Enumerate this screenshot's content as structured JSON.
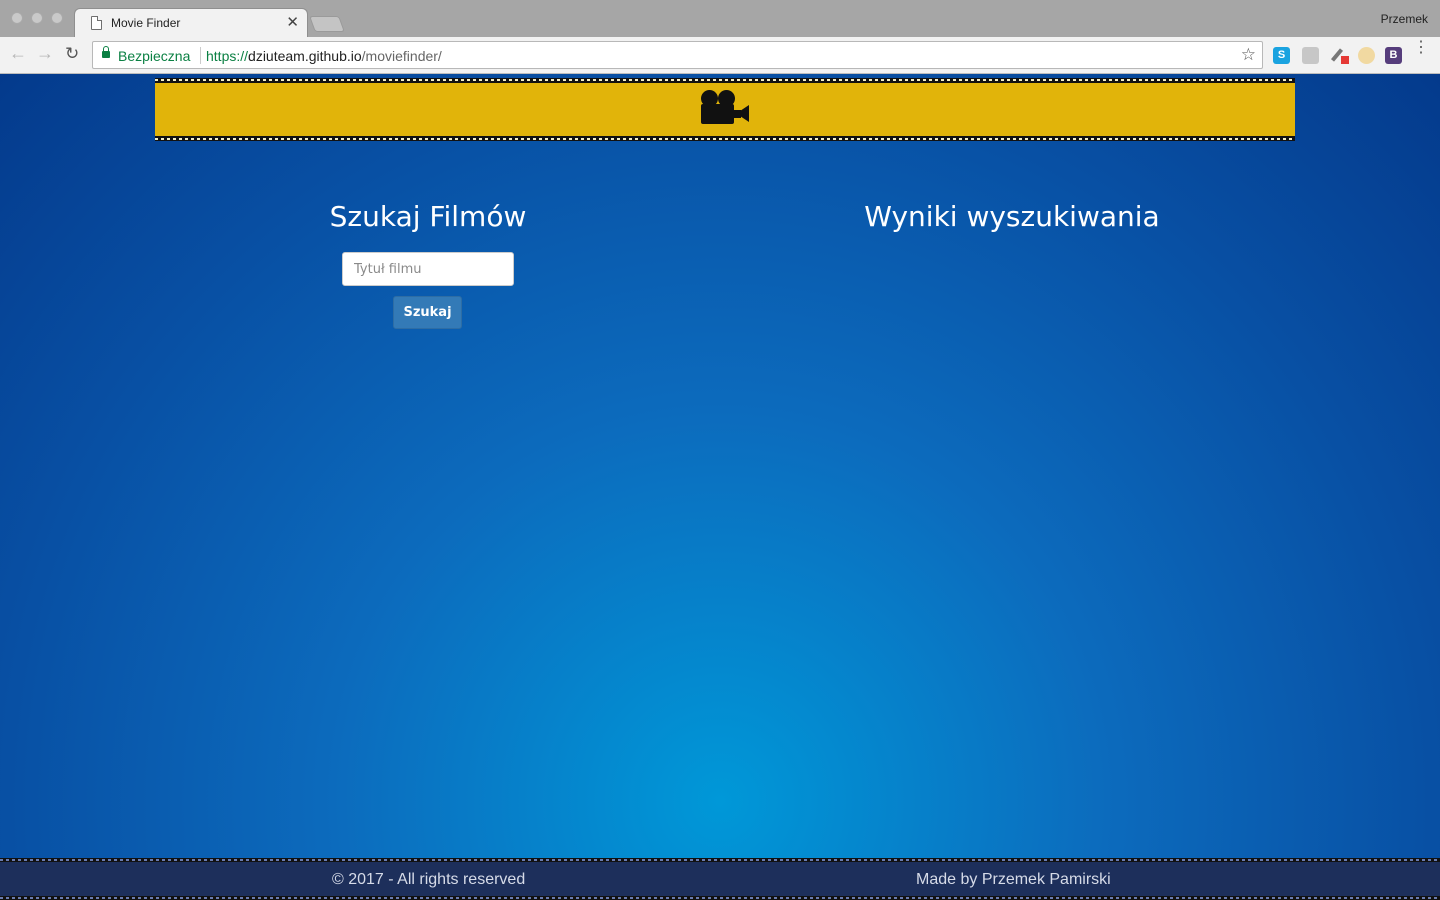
{
  "browser": {
    "tab_title": "Movie Finder",
    "tab_close": "✕",
    "profile_name": "Przemek",
    "secure_label": "Bezpieczna",
    "url_scheme": "https://",
    "url_host": "dziuteam.github.io",
    "url_path": "/moviefinder/",
    "back_icon": "←",
    "forward_icon": "→",
    "reload_icon": "↻",
    "bookmark_icon": "☆",
    "extensions": [
      {
        "name": "skype-icon",
        "label": "S"
      },
      {
        "name": "tool-extension-icon",
        "label": ""
      },
      {
        "name": "pin-extension-icon",
        "label": ""
      },
      {
        "name": "face-extension-icon",
        "label": ""
      },
      {
        "name": "bootstrap-extension-icon",
        "label": "B"
      }
    ],
    "menu_icon": "⋮"
  },
  "header": {
    "icon": "film-camera-icon",
    "background_color": "#e1b40a"
  },
  "search": {
    "title": "Szukaj Filmów",
    "input_placeholder": "Tytuł filmu",
    "input_value": "",
    "button_label": "Szukaj"
  },
  "results": {
    "title": "Wyniki wyszukiwania",
    "items": []
  },
  "footer": {
    "copyright": "© 2017 - All rights reserved",
    "author": "Made by Przemek Pamirski"
  }
}
